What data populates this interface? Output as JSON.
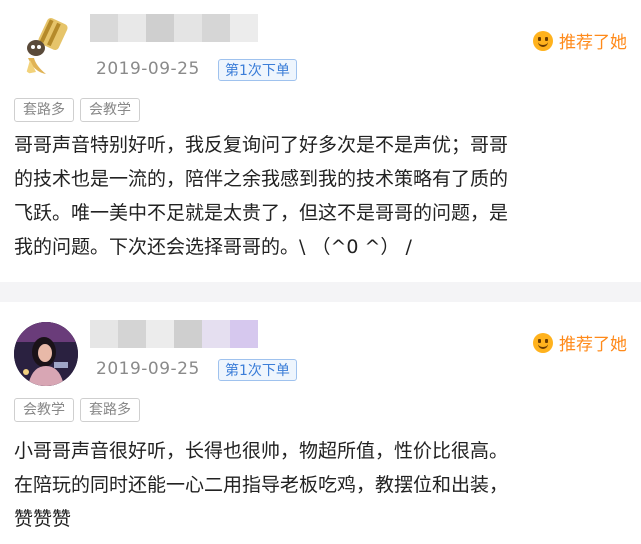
{
  "reviews": [
    {
      "date": "2019-09-25",
      "order_badge": "第1次下单",
      "recommend_label": "推荐了她",
      "tags": [
        "套路多",
        "会教学"
      ],
      "content_lines": [
        "哥哥声音特别好听，我反复询问了好多次是不是声优；哥哥",
        "的技术也是一流的，陪伴之余我感到我的技术策略有了质的",
        "飞跃。唯一美中不足就是太贵了，但这不是哥哥的问题，是",
        "我的问题。下次还会选择哥哥的。\\ （^0 ^） /"
      ]
    },
    {
      "date": "2019-09-25",
      "order_badge": "第1次下单",
      "recommend_label": "推荐了她",
      "tags": [
        "会教学",
        "套路多"
      ],
      "content_lines": [
        "小哥哥声音很好听，长得也很帅，物超所值，性价比很高。",
        "在陪玩的同时还能一心二用指导老板吃鸡，教摆位和出装，",
        "赞赞赞"
      ]
    }
  ],
  "colors": {
    "accent_orange": "#ff8a1a",
    "badge_blue": "#3b7dd8",
    "muted_gray": "#8a8a8a",
    "divider": "#f4f4f6"
  },
  "icons": {
    "recommend": "smiley-face-icon"
  }
}
